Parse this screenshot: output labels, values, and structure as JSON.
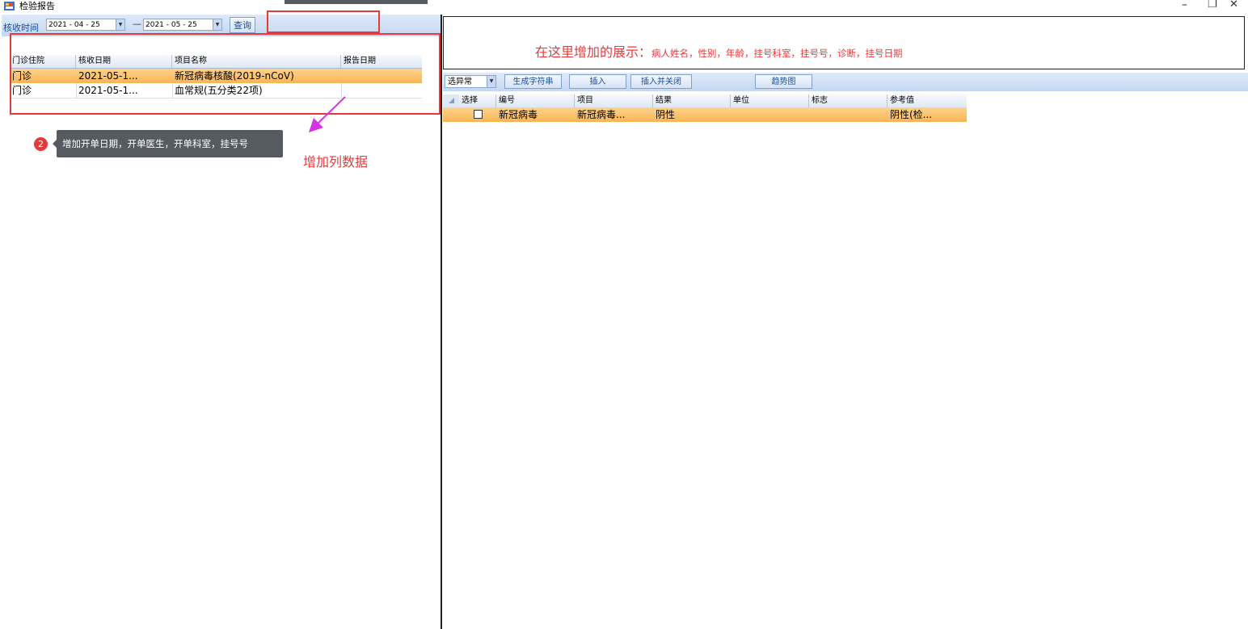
{
  "window": {
    "title": "检验报告",
    "minimize_glyph": "–",
    "restore_glyph": "❐",
    "close_glyph": "✕"
  },
  "left_toolbar": {
    "time_label": "核收时间",
    "date_from": "2021 - 04 - 25",
    "separator": "—",
    "date_to": "2021 - 05 - 25",
    "query_label": "查询",
    "dropdown_glyph": "▼"
  },
  "report_list": {
    "columns": [
      "门诊住院",
      "核收日期",
      "项目名称",
      "报告日期"
    ],
    "rows": [
      [
        "门诊",
        "2021-05-1...",
        "新冠病毒核酸(2019-nCoV)",
        ""
      ],
      [
        "门诊",
        "2021-05-1...",
        "血常规(五分类22项)",
        ""
      ]
    ]
  },
  "annotations": {
    "badge_number": "2",
    "tooltip_text": "增加开单日期，开单医生，开单科室，挂号号",
    "add_columns_text": "增加列数据",
    "info_prefix": "在这里增加的展示：",
    "info_fields": "病人姓名，性别，年龄，挂号科室，挂号号，诊断，挂号日期",
    "accent_color": "#e53a3a",
    "arrow_color": "#d633e3"
  },
  "right_toolbar": {
    "filter_value": "选异常",
    "buttons": [
      "生成字符串",
      "插入",
      "插入并关闭",
      "趋势图"
    ]
  },
  "result_grid": {
    "columns": [
      "选择",
      "编号",
      "项目",
      "结果",
      "单位",
      "标志",
      "参考值"
    ],
    "rows": [
      [
        "",
        "新冠病毒",
        "新冠病毒...",
        "阴性",
        "",
        "",
        "阴性(检..."
      ]
    ]
  }
}
